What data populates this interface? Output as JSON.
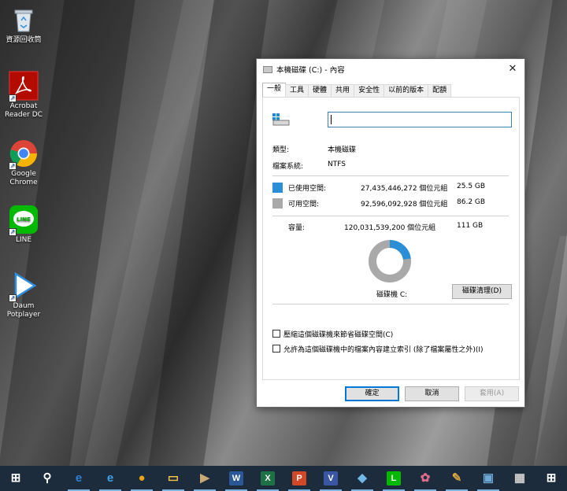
{
  "desktop": {
    "icons": [
      {
        "label": "資源回收筒",
        "icon": "recycle-bin-icon"
      },
      {
        "label": "Acrobat Reader DC",
        "icon": "acrobat-icon"
      },
      {
        "label": "Google Chrome",
        "icon": "chrome-icon"
      },
      {
        "label": "LINE",
        "icon": "line-icon"
      },
      {
        "label": "Daum Potplayer",
        "icon": "potplayer-icon"
      }
    ]
  },
  "dialog": {
    "title": "本機磁碟 (C:) - 內容",
    "close_glyph": "✕",
    "tabs": [
      "一般",
      "工具",
      "硬體",
      "共用",
      "安全性",
      "以前的版本",
      "配額"
    ],
    "active_tab": "一般",
    "name_value": "",
    "type_label": "類型:",
    "type_value": "本機磁碟",
    "fs_label": "檔案系統:",
    "fs_value": "NTFS",
    "used_label": "已使用空間:",
    "used_bytes": "27,435,446,272 個位元組",
    "used_size": "25.5 GB",
    "free_label": "可用空間:",
    "free_bytes": "92,596,092,928 個位元組",
    "free_size": "86.2 GB",
    "capacity_label": "容量:",
    "capacity_bytes": "120,031,539,200 個位元組",
    "capacity_size": "111 GB",
    "drive_caption": "磁碟機 C:",
    "cleanup_button": "磁碟清理(D)",
    "compress_label": "壓縮這個磁碟機來節省磁碟空間(C)",
    "index_label": "允許為這個磁碟機中的檔案內容建立索引 (除了檔案屬性之外)(I)",
    "compress_checked": false,
    "index_checked": false,
    "ok_button": "確定",
    "cancel_button": "取消",
    "apply_button": "套用(A)",
    "used_fraction": 0.2286,
    "colors": {
      "used": "#2a8fd6",
      "free": "#a9a9a9"
    }
  },
  "taskbar": {
    "items": [
      {
        "name": "start-icon",
        "glyph": "⊞",
        "color": "#ffffff"
      },
      {
        "name": "search-icon",
        "glyph": "⚲",
        "color": "#ffffff"
      },
      {
        "name": "edge-icon",
        "glyph": "e",
        "color": "#2f7fd4"
      },
      {
        "name": "ie-icon",
        "glyph": "e",
        "color": "#3ea0e6"
      },
      {
        "name": "chrome-icon",
        "glyph": "●",
        "color": "#e8a317"
      },
      {
        "name": "file-explorer-icon",
        "glyph": "▭",
        "color": "#f3c243"
      },
      {
        "name": "media-player-icon",
        "glyph": "▶",
        "color": "#c9a875"
      },
      {
        "name": "word-icon",
        "glyph": "W",
        "color": "#2b5797"
      },
      {
        "name": "excel-icon",
        "glyph": "X",
        "color": "#1e7145"
      },
      {
        "name": "powerpoint-icon",
        "glyph": "P",
        "color": "#d24726"
      },
      {
        "name": "visio-icon",
        "glyph": "V",
        "color": "#3955a3"
      },
      {
        "name": "app-icon",
        "glyph": "◆",
        "color": "#6fb8e8"
      },
      {
        "name": "line-icon",
        "glyph": "L",
        "color": "#00b900"
      },
      {
        "name": "app-icon-2",
        "glyph": "✿",
        "color": "#e06b8b"
      },
      {
        "name": "paint-icon",
        "glyph": "✎",
        "color": "#d9a441"
      },
      {
        "name": "remote-desktop-icon",
        "glyph": "▣",
        "color": "#6ea9d8"
      },
      {
        "name": "calculator-icon",
        "glyph": "▦",
        "color": "#cfcfcf"
      },
      {
        "name": "store-icon",
        "glyph": "⊞",
        "color": "#ffffff"
      }
    ]
  }
}
